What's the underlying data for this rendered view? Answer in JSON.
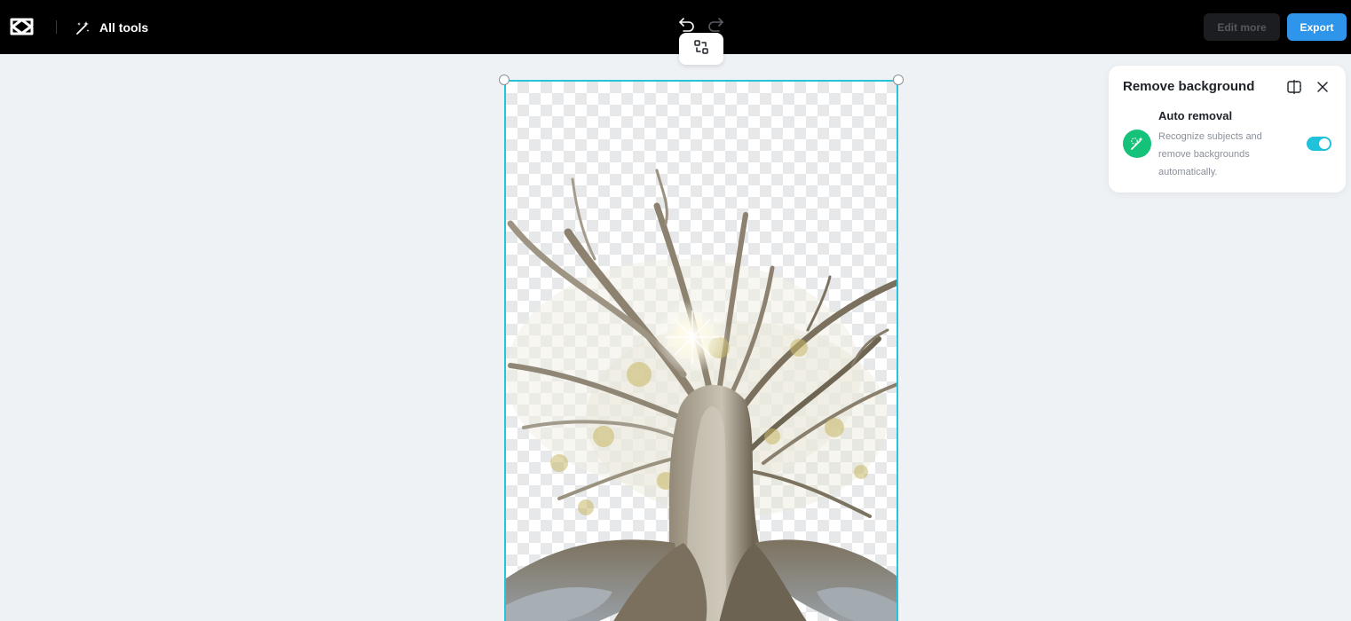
{
  "app": {
    "logo_icon": "capcut-logo-icon"
  },
  "topbar": {
    "all_tools_label": "All tools",
    "all_tools_icon": "magic-wand-icon",
    "undo_icon": "undo-icon",
    "redo_icon": "redo-icon",
    "edit_more_label": "Edit more",
    "export_label": "Export"
  },
  "canvas": {
    "replace_icon": "replace-swap-icon",
    "selection_color": "#27c3d8",
    "subject": "tree-with-background-removed"
  },
  "panel": {
    "title": "Remove background",
    "compare_icon": "compare-icon",
    "close_icon": "close-icon",
    "feature": {
      "icon": "auto-removal-icon",
      "title": "Auto removal",
      "description": "Recognize subjects and remove backgrounds automatically.",
      "enabled": true
    }
  },
  "colors": {
    "topbar_bg": "#000000",
    "export_bg": "#2f95ea",
    "toggle_on": "#1fc2db",
    "feature_icon_bg": "#15c27a"
  }
}
